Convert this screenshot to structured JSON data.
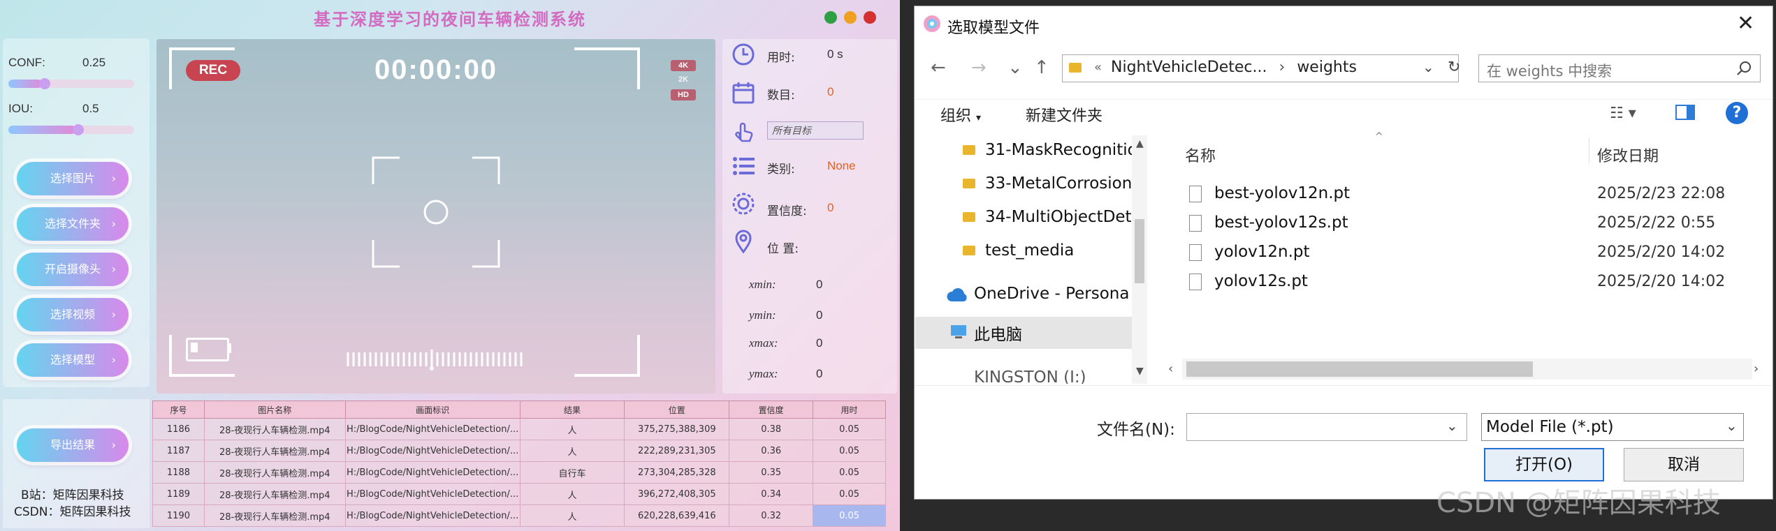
{
  "app": {
    "title": "基于深度学习的夜间车辆检测系统",
    "conf_label": "CONF:",
    "conf_value": "0.25",
    "iou_label": "IOU:",
    "iou_value": "0.5",
    "conf_slider_level": 0.25,
    "iou_slider_level": 0.5,
    "buttons": [
      "选择图片",
      "选择文件夹",
      "开启摄像头",
      "选择视频",
      "选择模型"
    ],
    "export_button": "导出结果",
    "rec": "REC",
    "timer": "00:00:00",
    "resolutions": [
      "4K",
      "2K",
      "HD"
    ],
    "info": {
      "time_label": "用时:",
      "time_value": "0 s",
      "count_label": "数目:",
      "count_value": "0",
      "target_select": "所有目标",
      "class_label": "类别:",
      "class_value": "None",
      "conf_label": "置信度:",
      "conf_value": "0",
      "pos_label": "位 置:",
      "coords": [
        {
          "label": "xmin:",
          "value": "0"
        },
        {
          "label": "ymin:",
          "value": "0"
        },
        {
          "label": "xmax:",
          "value": "0"
        },
        {
          "label": "ymax:",
          "value": "0"
        }
      ]
    },
    "table": {
      "headers": [
        "序号",
        "图片名称",
        "画面标识",
        "结果",
        "位置",
        "置信度",
        "用时"
      ],
      "rows": [
        [
          "1186",
          "28-夜现行人车辆检测.mp4",
          "H:/BlogCode/NightVehicleDetection/...",
          "人",
          "375,275,388,309",
          "0.38",
          "0.05"
        ],
        [
          "1187",
          "28-夜现行人车辆检测.mp4",
          "H:/BlogCode/NightVehicleDetection/...",
          "人",
          "222,289,231,305",
          "0.36",
          "0.05"
        ],
        [
          "1188",
          "28-夜现行人车辆检测.mp4",
          "H:/BlogCode/NightVehicleDetection/...",
          "自行车",
          "273,304,285,328",
          "0.35",
          "0.05"
        ],
        [
          "1189",
          "28-夜现行人车辆检测.mp4",
          "H:/BlogCode/NightVehicleDetection/...",
          "人",
          "396,272,408,305",
          "0.34",
          "0.05"
        ],
        [
          "1190",
          "28-夜现行人车辆检测.mp4",
          "H:/BlogCode/NightVehicleDetection/...",
          "人",
          "620,228,639,416",
          "0.32",
          "0.05"
        ]
      ]
    },
    "credit1": "B站：矩阵因果科技",
    "credit2": "CSDN：矩阵因果科技"
  },
  "dialog": {
    "title": "选取模型文件",
    "address_prefix": "«",
    "address_path": [
      "NightVehicleDetec...",
      "weights"
    ],
    "search_placeholder": "在 weights 中搜索",
    "organize": "组织",
    "new_folder": "新建文件夹",
    "nav_items": [
      {
        "name": "31-MaskRecognitio",
        "icon": "folder-icon"
      },
      {
        "name": "33-MetalCorrosion",
        "icon": "folder-icon"
      },
      {
        "name": "34-MultiObjectDet",
        "icon": "folder-icon"
      },
      {
        "name": "test_media",
        "icon": "folder-icon"
      },
      {
        "name": "OneDrive - Persona",
        "icon": "cloud-icon"
      },
      {
        "name": "此电脑",
        "icon": "computer-icon"
      },
      {
        "name": "KINGSTON (I:)",
        "icon": "drive-icon"
      }
    ],
    "columns": [
      "名称",
      "修改日期"
    ],
    "files": [
      {
        "name": "best-yolov12n.pt",
        "date": "2025/2/23 22:08"
      },
      {
        "name": "best-yolov12s.pt",
        "date": "2025/2/22 0:55"
      },
      {
        "name": "yolov12n.pt",
        "date": "2025/2/20 14:02"
      },
      {
        "name": "yolov12s.pt",
        "date": "2025/2/20 14:02"
      }
    ],
    "filename_label": "文件名(N):",
    "filename_value": "",
    "filter": "Model File (*.pt)",
    "open": "打开(O)",
    "cancel": "取消"
  },
  "watermark": "CSDN @矩阵因果科技",
  "colors": {
    "accent_pink": "#d36cc0",
    "rec_red": "#c84450",
    "orange_value": "#e8601c",
    "dialog_accent": "#1f6fd6"
  }
}
